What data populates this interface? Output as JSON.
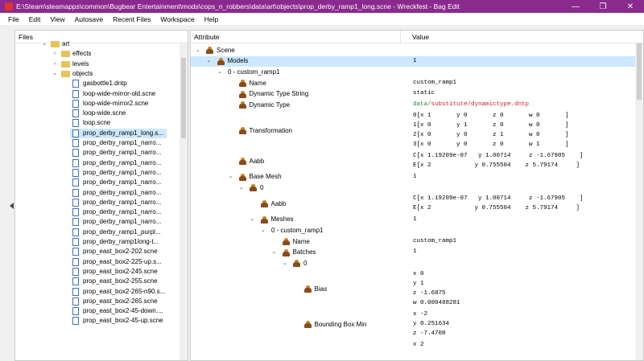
{
  "window": {
    "title": "E:\\Steam\\steamapps\\common\\Bugbear Entertainment\\mods\\cops_n_robbers\\data\\art\\objects\\prop_derby_ramp1_long.scne - Wreckfest - Bag Edit",
    "minimize": "—",
    "maximize": "❐",
    "close": "✕"
  },
  "menu": [
    "File",
    "Edit",
    "View",
    "Autosave",
    "Recent Files",
    "Workspace",
    "Help"
  ],
  "files_panel": {
    "header": "Files",
    "tree": [
      {
        "label": "art",
        "type": "folder",
        "level": 0,
        "expanded": true
      },
      {
        "label": "effects",
        "type": "folder",
        "level": 1,
        "expanded": false
      },
      {
        "label": "levels",
        "type": "folder",
        "level": 1,
        "expanded": false
      },
      {
        "label": "objects",
        "type": "folder",
        "level": 1,
        "expanded": true
      },
      {
        "label": "gasbottle1.dntp",
        "type": "file",
        "level": 2
      },
      {
        "label": "loop-wide-mirror-old.scne",
        "type": "file",
        "level": 2
      },
      {
        "label": "loop-wide-mirror2.scne",
        "type": "file",
        "level": 2
      },
      {
        "label": "loop-wide.scne",
        "type": "file",
        "level": 2
      },
      {
        "label": "loop.scne",
        "type": "file",
        "level": 2
      },
      {
        "label": "prop_derby_ramp1_long.s...",
        "type": "file",
        "level": 2,
        "selected": true
      },
      {
        "label": "prop_derby_ramp1_narro...",
        "type": "file",
        "level": 2
      },
      {
        "label": "prop_derby_ramp1_narro...",
        "type": "file",
        "level": 2
      },
      {
        "label": "prop_derby_ramp1_narro...",
        "type": "file",
        "level": 2
      },
      {
        "label": "prop_derby_ramp1_narro...",
        "type": "file",
        "level": 2
      },
      {
        "label": "prop_derby_ramp1_narro...",
        "type": "file",
        "level": 2
      },
      {
        "label": "prop_derby_ramp1_narro...",
        "type": "file",
        "level": 2
      },
      {
        "label": "prop_derby_ramp1_narro...",
        "type": "file",
        "level": 2
      },
      {
        "label": "prop_derby_ramp1_narro...",
        "type": "file",
        "level": 2
      },
      {
        "label": "prop_derby_ramp1_narro...",
        "type": "file",
        "level": 2
      },
      {
        "label": "prop_derby_ramp1_purpl...",
        "type": "file",
        "level": 2
      },
      {
        "label": "prop_derby_ramp1long-t...",
        "type": "file",
        "level": 2
      },
      {
        "label": "prop_east_box2-202.scne",
        "type": "file",
        "level": 2
      },
      {
        "label": "prop_east_box2-225-up.s...",
        "type": "file",
        "level": 2
      },
      {
        "label": "prop_east_box2-245.scne",
        "type": "file",
        "level": 2
      },
      {
        "label": "prop_east_box2-255.scne",
        "type": "file",
        "level": 2
      },
      {
        "label": "prop_east_box2-265-n90.s...",
        "type": "file",
        "level": 2
      },
      {
        "label": "prop_east_box2-265.scne",
        "type": "file",
        "level": 2
      },
      {
        "label": "prop_east_box2-45-down....",
        "type": "file",
        "level": 2
      },
      {
        "label": "prop_east_box2-45-up.scne",
        "type": "file",
        "level": 2
      }
    ]
  },
  "attr_panel": {
    "col_attribute": "Attribute",
    "col_value": "Value",
    "rows": [
      {
        "indent": 0,
        "exp": "v",
        "label": "Scene",
        "icon": true,
        "lines": [
          ""
        ]
      },
      {
        "indent": 1,
        "exp": "v",
        "label": "Models",
        "icon": true,
        "lines": [
          "1"
        ],
        "highlight": true
      },
      {
        "indent": 2,
        "exp": "v",
        "label": "0 - custom_ramp1",
        "icon": false,
        "lines": [
          ""
        ]
      },
      {
        "indent": 3,
        "exp": "",
        "label": "Name",
        "icon": true,
        "lines": [
          "custom_ramp1"
        ]
      },
      {
        "indent": 3,
        "exp": "",
        "label": "Dynamic Type String",
        "icon": true,
        "lines": [
          "static"
        ]
      },
      {
        "indent": 3,
        "exp": "",
        "label": "Dynamic Type",
        "icon": true,
        "lines": [
          ""
        ],
        "path": {
          "green": "data/",
          "red": "substitute/dynamictype.dntp"
        }
      },
      {
        "indent": 3,
        "exp": "",
        "label": "Transformation",
        "icon": true,
        "lines": [
          "0[x 1       y 0       z 0       w 0       ]",
          "1[x 0       y 1       z 0       w 0       ]",
          "2[x 0       y 0       z 1       w 0       ]",
          "3[x 0       y 0       z 0       w 1       ]"
        ]
      },
      {
        "indent": 3,
        "exp": "",
        "label": "Aabb",
        "icon": true,
        "lines": [
          "C[x 1.19209e-07   y 1.00714     z -1.67905    ]",
          "E[x 2            y 0.755504    z 5.79174     ]"
        ]
      },
      {
        "indent": 3,
        "exp": "v",
        "label": "Base Mesh",
        "icon": true,
        "lines": [
          "1"
        ]
      },
      {
        "indent": 4,
        "exp": "v",
        "label": "0",
        "icon": true,
        "lines": [
          ""
        ]
      },
      {
        "indent": 5,
        "exp": "",
        "label": "Aabb",
        "icon": true,
        "lines": [
          "C[x 1.19209e-07   y 1.00714     z -1.67905    ]",
          "E[x 2            y 0.755504    z 5.79174     ]"
        ]
      },
      {
        "indent": 5,
        "exp": "v",
        "label": "Meshes",
        "icon": true,
        "lines": [
          "1"
        ]
      },
      {
        "indent": 6,
        "exp": "v",
        "label": "0 - custom_ramp1",
        "icon": false,
        "lines": [
          ""
        ]
      },
      {
        "indent": 7,
        "exp": "",
        "label": "Name",
        "icon": true,
        "lines": [
          "custom_ramp1"
        ]
      },
      {
        "indent": 7,
        "exp": "v",
        "label": "Batches",
        "icon": true,
        "lines": [
          "1"
        ]
      },
      {
        "indent": 8,
        "exp": "v",
        "label": "0",
        "icon": true,
        "lines": [
          ""
        ]
      },
      {
        "indent": 9,
        "exp": "",
        "label": "Bias",
        "icon": true,
        "lines": [
          "x 0",
          "y 1",
          "z -1.6875",
          "w 0.000488281"
        ]
      },
      {
        "indent": 9,
        "exp": "",
        "label": "Bounding Box Min",
        "icon": true,
        "lines": [
          "x -2",
          "y 0.251634",
          "z -7.4708"
        ]
      },
      {
        "indent": 9,
        "exp": "",
        "label": "",
        "icon": false,
        "lines": [
          "x 2"
        ]
      }
    ]
  }
}
